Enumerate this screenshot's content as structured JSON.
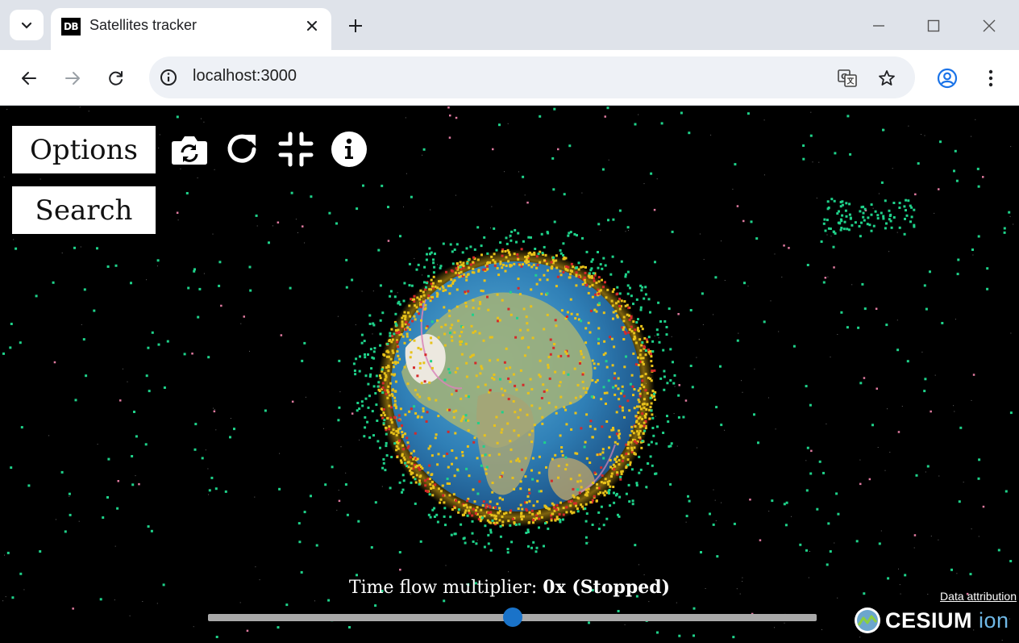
{
  "browser": {
    "tab_title": "Satellites tracker",
    "favicon_text": "DB",
    "url": "localhost:3000"
  },
  "app": {
    "options_label": "Options",
    "search_label": "Search",
    "toolbar_icons": [
      "camera-rotate-icon",
      "reset-view-icon",
      "compress-icon",
      "info-icon"
    ],
    "time_flow_label": "Time flow multiplier:",
    "time_flow_value": "0x (Stopped)",
    "time_flow_slider_fraction": 0.5,
    "data_attribution": "Data attribution",
    "cesium_logo_text": "CESIUM",
    "cesium_logo_suffix": "ion"
  },
  "colors": {
    "satellite_green": "#1fd28a",
    "satellite_yellow": "#e8c21a",
    "satellite_red": "#d52a2a",
    "satellite_pink": "#e07aa0",
    "slider_thumb": "#1a73c9"
  }
}
